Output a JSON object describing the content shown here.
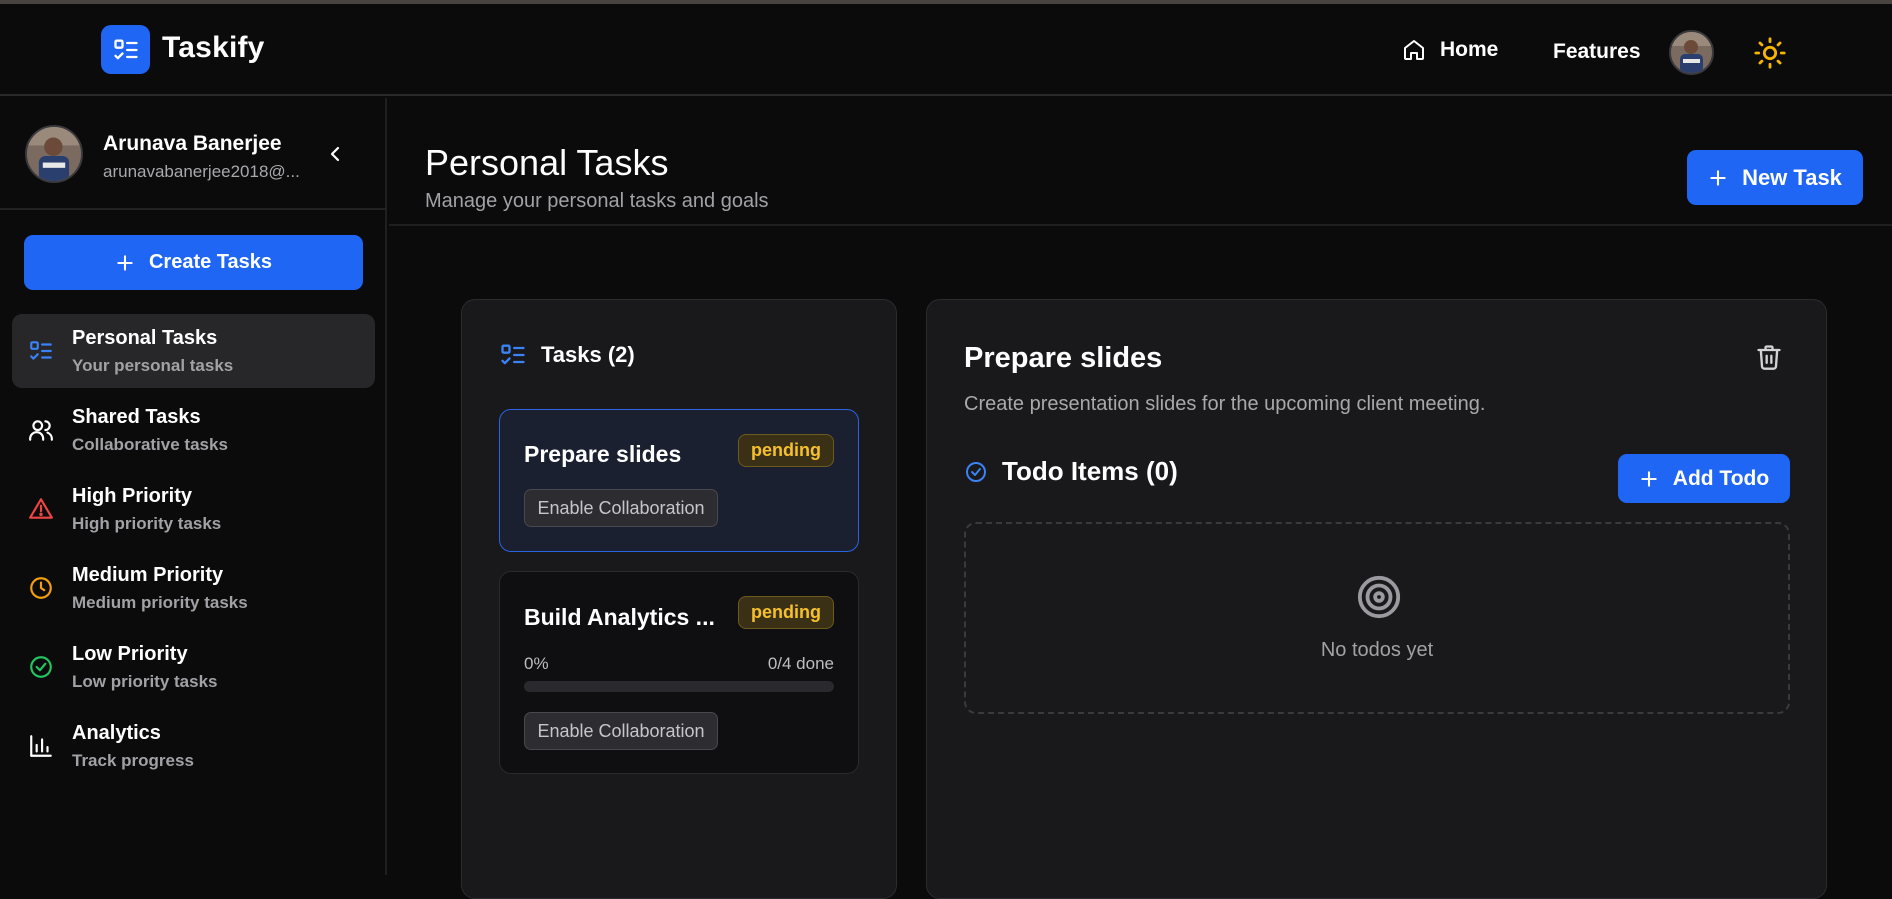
{
  "app": {
    "name": "Taskify"
  },
  "topnav": {
    "home": "Home",
    "features": "Features"
  },
  "user": {
    "name": "Arunava Banerjee",
    "email": "arunavabanerjee2018@..."
  },
  "sidebar": {
    "create_label": "Create Tasks",
    "items": [
      {
        "title": "Personal Tasks",
        "subtitle": "Your personal tasks",
        "icon": "list-check-icon",
        "active": true
      },
      {
        "title": "Shared Tasks",
        "subtitle": "Collaborative tasks",
        "icon": "users-icon"
      },
      {
        "title": "High Priority",
        "subtitle": "High priority tasks",
        "icon": "alert-triangle-icon",
        "color": "#ef4444"
      },
      {
        "title": "Medium Priority",
        "subtitle": "Medium priority tasks",
        "icon": "clock-icon",
        "color": "#f59e0b"
      },
      {
        "title": "Low Priority",
        "subtitle": "Low priority tasks",
        "icon": "check-circle-icon",
        "color": "#22c55e"
      },
      {
        "title": "Analytics",
        "subtitle": "Track progress",
        "icon": "bar-chart-icon"
      }
    ]
  },
  "page": {
    "title": "Personal Tasks",
    "subtitle": "Manage your personal tasks and goals",
    "new_task_label": "New Task"
  },
  "tasks": {
    "header": "Tasks (2)",
    "list": [
      {
        "title": "Prepare slides",
        "status": "pending",
        "collab_label": "Enable Collaboration",
        "selected": true
      },
      {
        "title": "Build Analytics ...",
        "status": "pending",
        "progress_pct_label": "0%",
        "progress_done_label": "0/4 done",
        "progress": 0,
        "collab_label": "Enable Collaboration"
      }
    ]
  },
  "detail": {
    "title": "Prepare slides",
    "description": "Create presentation slides for the upcoming client meeting.",
    "todo_header": "Todo Items (0)",
    "add_todo_label": "Add Todo",
    "empty_text": "No todos yet"
  },
  "colors": {
    "accent": "#1f66f5",
    "pending": "#f6c02c",
    "background": "#0b0b0c"
  }
}
